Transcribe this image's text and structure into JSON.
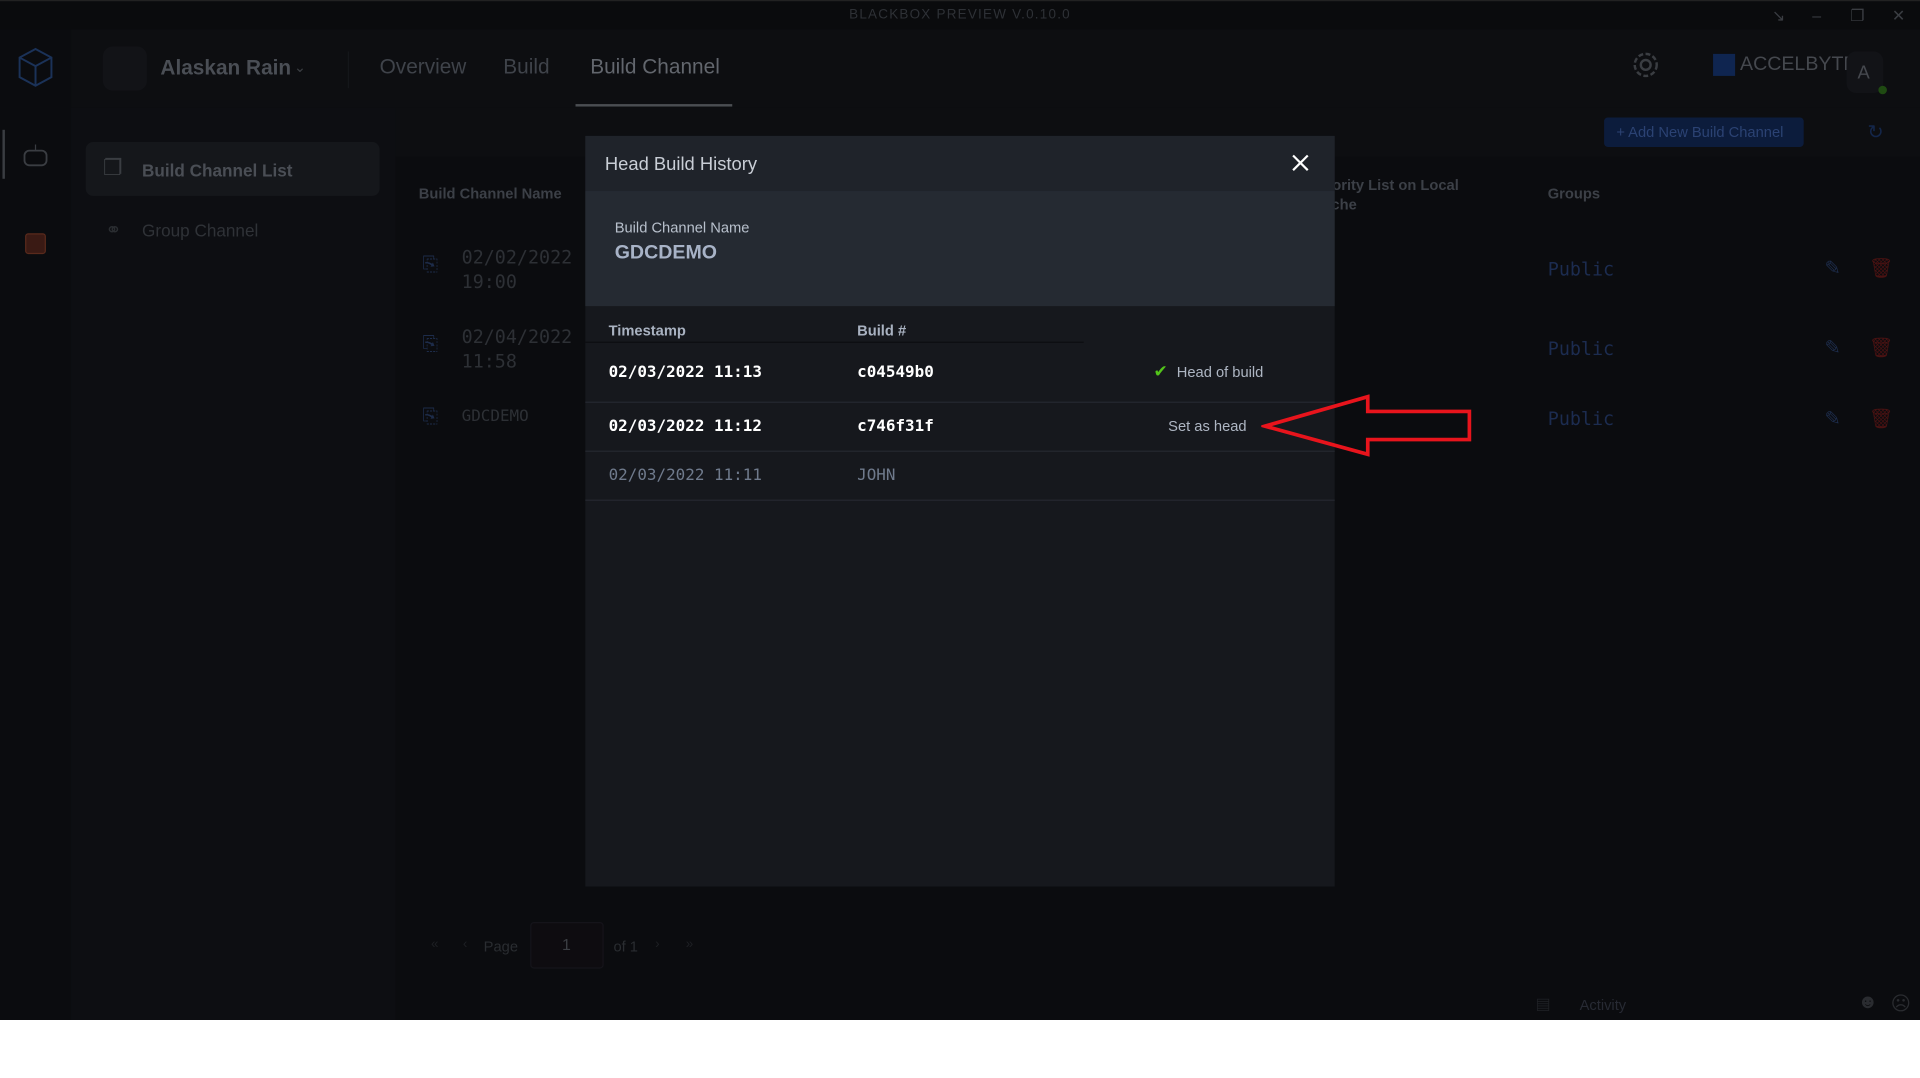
{
  "window": {
    "title": "BLACKBOX PREVIEW V.0.10.0"
  },
  "header": {
    "project_name": "Alaskan Rain",
    "tabs": [
      {
        "label": "Overview"
      },
      {
        "label": "Build"
      },
      {
        "label": "Build Channel",
        "active": true
      }
    ],
    "brand": "ACCELBYTE",
    "avatar_letter": "A"
  },
  "sidebar": {
    "items": [
      {
        "label": "Build Channel List",
        "active": true
      },
      {
        "label": "Group Channel"
      }
    ]
  },
  "main": {
    "add_button": "+ Add New Build Channel",
    "columns": {
      "name": "Build Channel Name",
      "priority": "Priority List on Local Cache",
      "groups": "Groups"
    },
    "rows": [
      {
        "name_line1": "02/02/2022",
        "name_line2": "19:00",
        "group": "Public"
      },
      {
        "name_line1": "02/04/2022",
        "name_line2": "11:58",
        "group": "Public"
      },
      {
        "name_line1": "GDCDEMO",
        "name_line2": "",
        "group": "Public"
      }
    ],
    "pagination": {
      "page_label": "Page",
      "page": "1",
      "of_label": "of 1"
    },
    "activity_label": "Activity"
  },
  "modal": {
    "title": "Head Build History",
    "name_label": "Build Channel Name",
    "name_value": "GDCDEMO",
    "columns": {
      "timestamp": "Timestamp",
      "build": "Build #"
    },
    "rows": [
      {
        "timestamp": "02/03/2022 11:13",
        "build": "c04549b0",
        "status": "Head of build"
      },
      {
        "timestamp": "02/03/2022 11:12",
        "build": "c746f31f",
        "action": "Set as head"
      },
      {
        "timestamp": "02/03/2022 11:11",
        "build": "JOHN"
      }
    ]
  },
  "colors": {
    "accent": "#1d4ed8",
    "check": "#52c41a",
    "annotation_arrow": "#e8141c",
    "delete": "#7a1414"
  }
}
